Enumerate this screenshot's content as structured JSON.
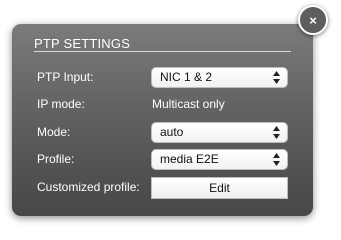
{
  "dialog": {
    "title": "PTP SETTINGS",
    "close_label": "×"
  },
  "fields": {
    "ptp_input": {
      "label": "PTP Input:",
      "value": "NIC 1 & 2"
    },
    "ip_mode": {
      "label": "IP mode:",
      "value": "Multicast only"
    },
    "mode": {
      "label": "Mode:",
      "value": "auto"
    },
    "profile": {
      "label": "Profile:",
      "value": "media E2E"
    },
    "customized_profile": {
      "label": "Customized profile:",
      "button_label": "Edit"
    }
  },
  "icons": {
    "close": "close-icon",
    "select_arrows": "up-down-arrows-icon"
  }
}
